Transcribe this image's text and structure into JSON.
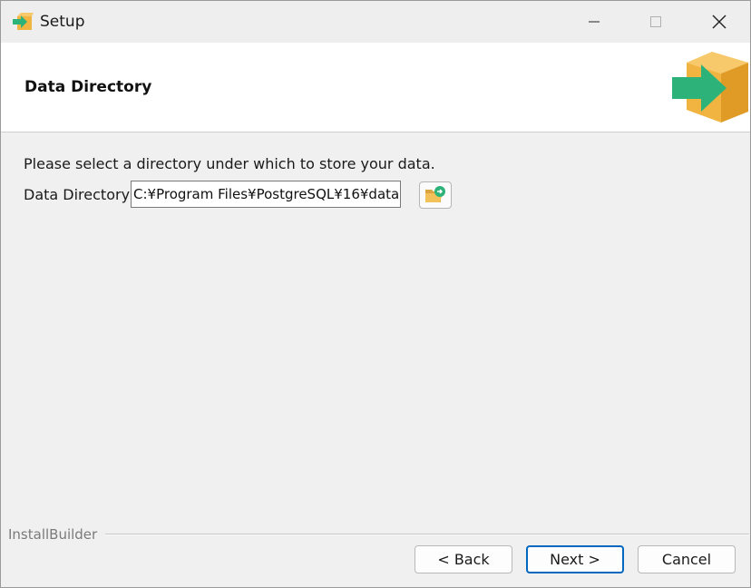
{
  "window": {
    "title": "Setup",
    "controls": {
      "minimize": "minimize",
      "maximize": "maximize",
      "close": "close"
    }
  },
  "header": {
    "title": "Data Directory"
  },
  "body": {
    "instruction": "Please select a directory under which to store your data.",
    "field_label": "Data Directory",
    "field_value": "C:¥Program Files¥PostgreSQL¥16¥data"
  },
  "footer": {
    "brand": "InstallBuilder",
    "back_label": "< Back",
    "next_label": "Next >",
    "cancel_label": "Cancel"
  },
  "colors": {
    "accent": "#0067c0",
    "logo_green": "#2db37a",
    "logo_box": "#f2b441"
  }
}
